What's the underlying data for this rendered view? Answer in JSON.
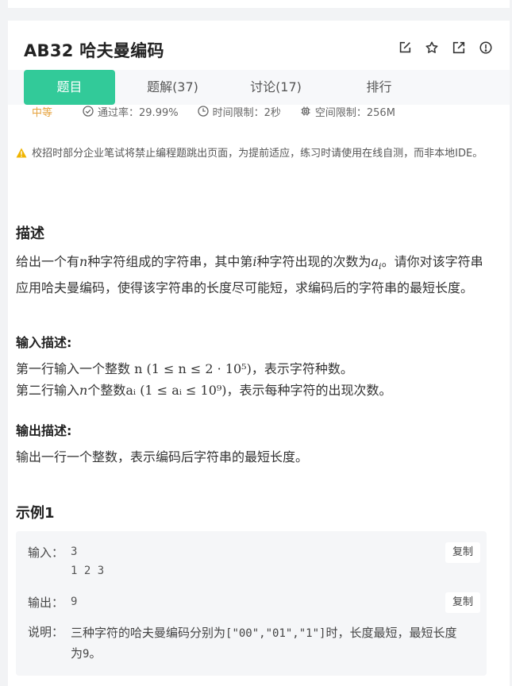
{
  "problem": {
    "title": "AB32  哈夫曼编码",
    "tabs": [
      "题目",
      "题解(37)",
      "讨论(17)",
      "排行"
    ],
    "difficulty": "中等",
    "pass_rate": "通过率：29.99%",
    "time_limit": "时间限制：2秒",
    "space_limit": "空间限制：256M",
    "notice": "校招时部分企业笔试将禁止编程题跳出页面，为提前适应，练习时请使用在线自测，而非本地IDE。"
  },
  "description": {
    "heading": "描述",
    "t1": "给出一个有",
    "v_n": "n",
    "t2": "种字符组成的字符串，其中第",
    "v_i": "i",
    "t3": "种字符出现的次数为",
    "v_ai": "a",
    "v_ai_sub": "i",
    "t4": "。请你对该字符串应用哈夫曼编码，使得该字符串的长度尽可能短，求编码后的字符串的最短长度。"
  },
  "input_desc": {
    "heading": "输入描述:",
    "l1_a": "第一行输入一个整数",
    "l1_math": "n (1 ≤ n ≤ 2 · 10⁵)",
    "l1_b": "，表示字符种数。",
    "l2_a": "第二行输入",
    "l2_n": "n",
    "l2_b": "个整数",
    "l2_math": "aᵢ (1 ≤ aᵢ ≤ 10⁹)",
    "l2_c": "，表示每种字符的出现次数。"
  },
  "output_desc": {
    "heading": "输出描述:",
    "text": "输出一行一个整数，表示编码后字符串的最短长度。"
  },
  "example": {
    "heading": "示例1",
    "input_label": "输入：",
    "input_line1": "3",
    "input_line2": "1 2 3",
    "output_label": "输出：",
    "output_value": "9",
    "note_label": "说明：",
    "note_a": "三种字符的哈夫曼编码分别为",
    "note_code": "[\"00\",\"01\",\"1\"]",
    "note_b": "时，长度最短，最短长度为",
    "note_num": "9",
    "note_c": "。",
    "copy_label": "复制"
  },
  "colors": {
    "accent": "#32ca99",
    "difficulty": "#e6a23c",
    "warning": "#f0b400"
  }
}
